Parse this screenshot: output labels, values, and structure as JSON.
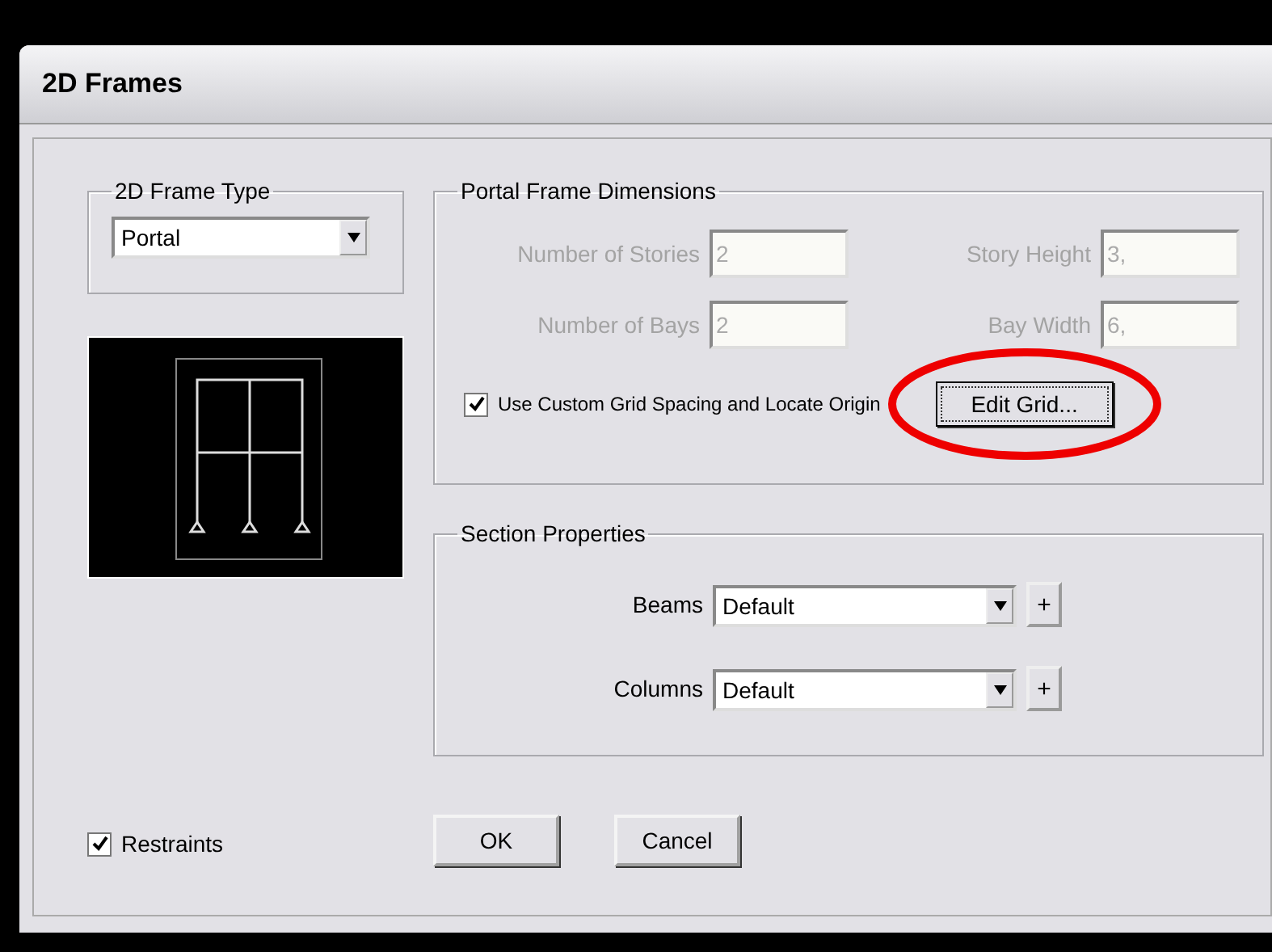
{
  "window": {
    "title": "2D Frames"
  },
  "frame_type": {
    "label": "2D Frame Type",
    "value": "Portal"
  },
  "portal_dimensions": {
    "title": "Portal Frame Dimensions",
    "fields": [
      {
        "label": "Number of Stories",
        "value": "2",
        "disabled": true
      },
      {
        "label": "Story Height",
        "value": "3,",
        "disabled": true
      },
      {
        "label": "Number of Bays",
        "value": "2",
        "disabled": true
      },
      {
        "label": "Bay Width",
        "value": "6,",
        "disabled": true
      }
    ],
    "custom_grid": {
      "label": "Use Custom Grid Spacing and Locate Origin",
      "checked": true
    },
    "edit_grid_button": "Edit Grid..."
  },
  "section_properties": {
    "title": "Section Properties",
    "rows": [
      {
        "label": "Beams",
        "value": "Default",
        "add": "+"
      },
      {
        "label": "Columns",
        "value": "Default",
        "add": "+"
      }
    ]
  },
  "restraints": {
    "label": "Restraints",
    "checked": true
  },
  "buttons": [
    "OK",
    "Cancel"
  ]
}
